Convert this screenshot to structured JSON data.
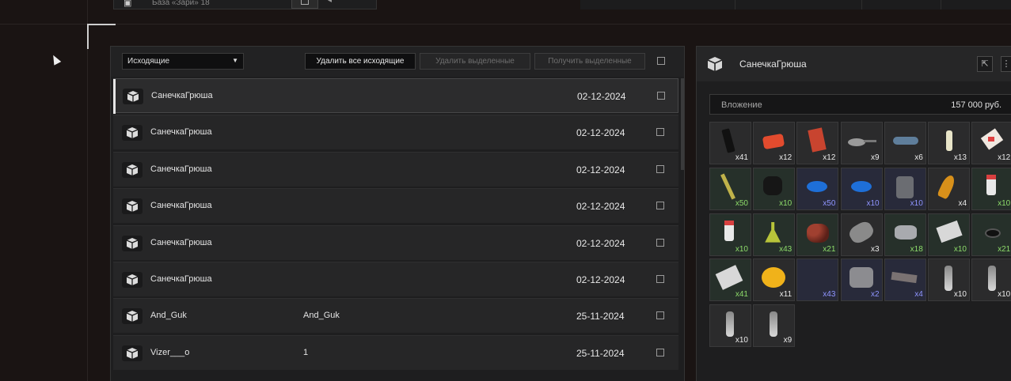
{
  "topbar": {
    "base_label": "База «Зари» 18"
  },
  "toolbar": {
    "dropdown_value": "Исходящие",
    "delete_all_label": "Удалить все исходящие",
    "delete_selected_label": "Удалить выделенные",
    "receive_selected_label": "Получить выделенные"
  },
  "messages": [
    {
      "sender": "СанечкаГрюша",
      "text": "",
      "date": "02-12-2024"
    },
    {
      "sender": "СанечкаГрюша",
      "text": "",
      "date": "02-12-2024"
    },
    {
      "sender": "СанечкаГрюша",
      "text": "",
      "date": "02-12-2024"
    },
    {
      "sender": "СанечкаГрюша",
      "text": "",
      "date": "02-12-2024"
    },
    {
      "sender": "СанечкаГрюша",
      "text": "",
      "date": "02-12-2024"
    },
    {
      "sender": "СанечкаГрюша",
      "text": "",
      "date": "02-12-2024"
    },
    {
      "sender": "And_Guk",
      "text": "And_Guk",
      "date": "25-11-2024"
    },
    {
      "sender": "Vizer___o",
      "text": "1",
      "date": "25-11-2024"
    }
  ],
  "detail": {
    "title": "СанечкаГрюша",
    "attachment_label": "Вложение",
    "attachment_amount": "157 000 руб."
  },
  "items": [
    {
      "icon": "knife-icon",
      "count": "x41",
      "rarity": "common"
    },
    {
      "icon": "red-pack-icon",
      "count": "x12",
      "rarity": "common"
    },
    {
      "icon": "red-box-icon",
      "count": "x12",
      "rarity": "common"
    },
    {
      "icon": "frying-pan-icon",
      "count": "x9",
      "rarity": "common"
    },
    {
      "icon": "goggles-icon",
      "count": "x6",
      "rarity": "common"
    },
    {
      "icon": "bottle-icon",
      "count": "x13",
      "rarity": "common"
    },
    {
      "icon": "paper-icon",
      "count": "x12",
      "rarity": "common"
    },
    {
      "icon": "stick-icon",
      "count": "x50",
      "rarity": "uncommon"
    },
    {
      "icon": "black-bag-icon",
      "count": "x10",
      "rarity": "uncommon"
    },
    {
      "icon": "blue-blob-icon",
      "count": "x50",
      "rarity": "rare"
    },
    {
      "icon": "blue-blob-icon",
      "count": "x10",
      "rarity": "rare"
    },
    {
      "icon": "plate-icon",
      "count": "x10",
      "rarity": "rare"
    },
    {
      "icon": "yellow-feather-icon",
      "count": "x4",
      "rarity": "common"
    },
    {
      "icon": "pill-bottle-icon",
      "count": "x10",
      "rarity": "uncommon"
    },
    {
      "icon": "pill-bottle-icon",
      "count": "x10",
      "rarity": "uncommon"
    },
    {
      "icon": "flask-icon",
      "count": "x43",
      "rarity": "uncommon"
    },
    {
      "icon": "berries-icon",
      "count": "x21",
      "rarity": "uncommon"
    },
    {
      "icon": "fish-icon",
      "count": "x3",
      "rarity": "common"
    },
    {
      "icon": "rock-icon",
      "count": "x18",
      "rarity": "uncommon"
    },
    {
      "icon": "paper-pack-icon",
      "count": "x10",
      "rarity": "uncommon"
    },
    {
      "icon": "dark-shell-icon",
      "count": "x21",
      "rarity": "uncommon"
    },
    {
      "icon": "foil-icon",
      "count": "x41",
      "rarity": "uncommon"
    },
    {
      "icon": "yellow-fruit-icon",
      "count": "x11",
      "rarity": "common"
    },
    {
      "icon": "empty-icon",
      "count": "x43",
      "rarity": "rare"
    },
    {
      "icon": "engine-part-icon",
      "count": "x2",
      "rarity": "rare"
    },
    {
      "icon": "flat-slab-icon",
      "count": "x4",
      "rarity": "rare"
    },
    {
      "icon": "vial-icon",
      "count": "x10",
      "rarity": "common"
    },
    {
      "icon": "vial-icon",
      "count": "x10",
      "rarity": "common"
    },
    {
      "icon": "vial-icon",
      "count": "x10",
      "rarity": "common"
    },
    {
      "icon": "vial-icon",
      "count": "x9",
      "rarity": "common"
    }
  ]
}
